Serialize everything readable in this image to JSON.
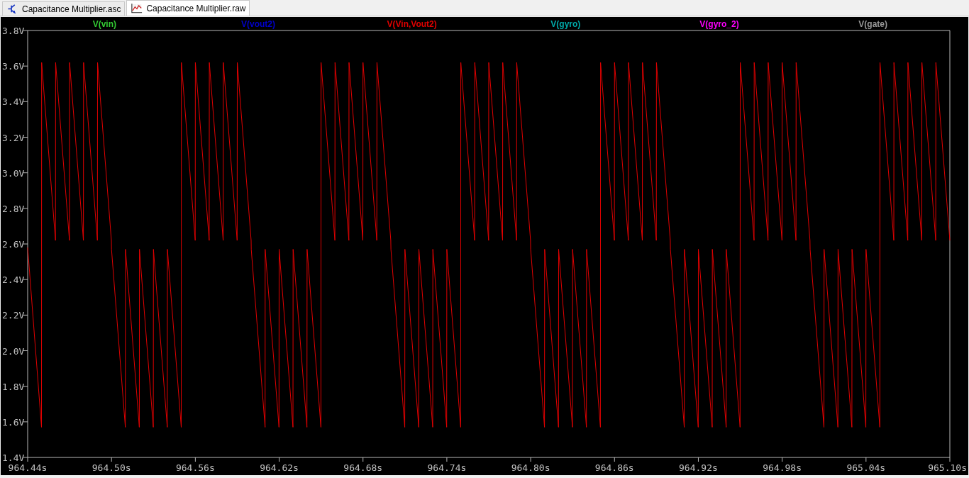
{
  "tabs": [
    {
      "label": "Capacitance Multiplier.asc",
      "kind": "schematic",
      "selected": false
    },
    {
      "label": "Capacitance Multiplier.raw",
      "kind": "waveform",
      "selected": true
    }
  ],
  "plot": {
    "chart_data": {
      "type": "line",
      "xlim": [
        964.44,
        965.1
      ],
      "ylim": [
        1.4,
        3.8
      ],
      "yticks": [
        {
          "value": 1.4,
          "label": "1.4V"
        },
        {
          "value": 1.6,
          "label": "1.6V"
        },
        {
          "value": 1.8,
          "label": "1.8V"
        },
        {
          "value": 2.0,
          "label": "2.0V"
        },
        {
          "value": 2.2,
          "label": "2.2V"
        },
        {
          "value": 2.4,
          "label": "2.4V"
        },
        {
          "value": 2.6,
          "label": "2.6V"
        },
        {
          "value": 2.8,
          "label": "2.8V"
        },
        {
          "value": 3.0,
          "label": "3.0V"
        },
        {
          "value": 3.2,
          "label": "3.2V"
        },
        {
          "value": 3.4,
          "label": "3.4V"
        },
        {
          "value": 3.6,
          "label": "3.6V"
        },
        {
          "value": 3.8,
          "label": "3.8V"
        }
      ],
      "xticks": [
        {
          "value": 964.44,
          "label": "964.44s"
        },
        {
          "value": 964.5,
          "label": "964.50s"
        },
        {
          "value": 964.56,
          "label": "964.56s"
        },
        {
          "value": 964.62,
          "label": "964.62s"
        },
        {
          "value": 964.68,
          "label": "964.68s"
        },
        {
          "value": 964.74,
          "label": "964.74s"
        },
        {
          "value": 964.8,
          "label": "964.80s"
        },
        {
          "value": 964.86,
          "label": "964.86s"
        },
        {
          "value": 964.92,
          "label": "964.92s"
        },
        {
          "value": 964.98,
          "label": "964.98s"
        },
        {
          "value": 965.04,
          "label": "965.04s"
        },
        {
          "value": 965.1,
          "label": "965.10s"
        }
      ],
      "x": [
        964.44,
        964.4499,
        964.45,
        964.4599,
        964.46,
        964.4699,
        964.47,
        964.4799,
        964.48,
        964.4899,
        964.49,
        964.4999,
        964.5,
        964.5099,
        964.51,
        964.5199,
        964.52,
        964.5299,
        964.53,
        964.5399,
        964.54,
        964.5499,
        964.55,
        964.5599,
        964.56,
        964.5699,
        964.57,
        964.5799,
        964.58,
        964.5899,
        964.59,
        964.5999,
        964.6,
        964.6099,
        964.61,
        964.6199,
        964.62,
        964.6299,
        964.63,
        964.6399,
        964.64,
        964.6499,
        964.65,
        964.6599,
        964.66,
        964.6699,
        964.67,
        964.6799,
        964.68,
        964.6899,
        964.69,
        964.6999,
        964.7,
        964.7099,
        964.71,
        964.7199,
        964.72,
        964.7299,
        964.73,
        964.7399,
        964.74,
        964.7499,
        964.75,
        964.7599,
        964.76,
        964.7699,
        964.77,
        964.7799,
        964.78,
        964.7899,
        964.79,
        964.7999,
        964.8,
        964.8099,
        964.81,
        964.8199,
        964.82,
        964.8299,
        964.83,
        964.8399,
        964.84,
        964.8499,
        964.85,
        964.8599,
        964.86,
        964.8699,
        964.87,
        964.8799,
        964.88,
        964.8899,
        964.89,
        964.8999,
        964.9,
        964.9099,
        964.91,
        964.9199,
        964.92,
        964.9299,
        964.93,
        964.9399,
        964.94,
        964.9499,
        964.95,
        964.9599,
        964.96,
        964.9699,
        964.97,
        964.9799,
        964.98,
        964.9899,
        964.99,
        964.9999,
        965.0,
        965.0099,
        965.01,
        965.0199,
        965.02,
        965.0299,
        965.03,
        965.0399,
        965.04,
        965.0499,
        965.05,
        965.0599,
        965.06,
        965.0699,
        965.07,
        965.0799,
        965.08,
        965.0899,
        965.09,
        965.1
      ],
      "series": [
        {
          "name": "V(vin)",
          "color": "#33cc33",
          "values": [
            null,
            null,
            null,
            null,
            null,
            null,
            null,
            null,
            null,
            null,
            null,
            null,
            null,
            null,
            null,
            null,
            null,
            null,
            null,
            null,
            null,
            null,
            null,
            null,
            null,
            null,
            null,
            null,
            null,
            null,
            null,
            null,
            null,
            null,
            null,
            null,
            null,
            null,
            null,
            null,
            null,
            null,
            null,
            null,
            null,
            null,
            null,
            null,
            null,
            null,
            null,
            null,
            null,
            null,
            null,
            null,
            null,
            null,
            null,
            null,
            null,
            null,
            null,
            null,
            null,
            null,
            null,
            null,
            null,
            null,
            null,
            null,
            null,
            null,
            null,
            null,
            null,
            null,
            null,
            null,
            null,
            null,
            null,
            null,
            null,
            null,
            null,
            null,
            null,
            null,
            null,
            null,
            null,
            null,
            null,
            null,
            null,
            null,
            null,
            null,
            null,
            null,
            null,
            null,
            null,
            null,
            null,
            null,
            null,
            null,
            null,
            null,
            null,
            null,
            null,
            null,
            null,
            null,
            null,
            null,
            null,
            null,
            null,
            null,
            null,
            null,
            null,
            null,
            null,
            null,
            null,
            null
          ]
        },
        {
          "name": "V(vout2)",
          "color": "#0000cc",
          "values": [
            null,
            null,
            null,
            null,
            null,
            null,
            null,
            null,
            null,
            null,
            null,
            null,
            null,
            null,
            null,
            null,
            null,
            null,
            null,
            null,
            null,
            null,
            null,
            null,
            null,
            null,
            null,
            null,
            null,
            null,
            null,
            null,
            null,
            null,
            null,
            null,
            null,
            null,
            null,
            null,
            null,
            null,
            null,
            null,
            null,
            null,
            null,
            null,
            null,
            null,
            null,
            null,
            null,
            null,
            null,
            null,
            null,
            null,
            null,
            null,
            null,
            null,
            null,
            null,
            null,
            null,
            null,
            null,
            null,
            null,
            null,
            null,
            null,
            null,
            null,
            null,
            null,
            null,
            null,
            null,
            null,
            null,
            null,
            null,
            null,
            null,
            null,
            null,
            null,
            null,
            null,
            null,
            null,
            null,
            null,
            null,
            null,
            null,
            null,
            null,
            null,
            null,
            null,
            null,
            null,
            null,
            null,
            null,
            null,
            null,
            null,
            null,
            null,
            null,
            null,
            null,
            null,
            null,
            null,
            null,
            null,
            null,
            null,
            null,
            null,
            null,
            null,
            null,
            null,
            null,
            null,
            null
          ]
        },
        {
          "name": "V(Vin,Vout2)",
          "color": "#e00000",
          "values": [
            2.58,
            1.57,
            3.62,
            2.62,
            3.62,
            2.62,
            3.62,
            2.62,
            3.62,
            2.62,
            3.62,
            2.62,
            2.57,
            1.57,
            2.57,
            1.57,
            2.57,
            1.57,
            2.57,
            1.57,
            2.57,
            1.57,
            3.62,
            2.62,
            3.62,
            2.62,
            3.62,
            2.62,
            3.62,
            2.62,
            3.62,
            2.62,
            2.57,
            1.57,
            2.57,
            1.57,
            2.57,
            1.57,
            2.57,
            1.57,
            2.57,
            1.57,
            3.62,
            2.62,
            3.62,
            2.62,
            3.62,
            2.62,
            3.62,
            2.62,
            3.62,
            2.62,
            2.57,
            1.57,
            2.57,
            1.57,
            2.57,
            1.57,
            2.57,
            1.57,
            2.57,
            1.57,
            3.62,
            2.62,
            3.62,
            2.62,
            3.62,
            2.62,
            3.62,
            2.62,
            3.62,
            2.62,
            2.57,
            1.57,
            2.57,
            1.57,
            2.57,
            1.57,
            2.57,
            1.57,
            2.57,
            1.57,
            3.62,
            2.62,
            3.62,
            2.62,
            3.62,
            2.62,
            3.62,
            2.62,
            3.62,
            2.62,
            2.57,
            1.57,
            2.57,
            1.57,
            2.57,
            1.57,
            2.57,
            1.57,
            2.57,
            1.57,
            3.62,
            2.62,
            3.62,
            2.62,
            3.62,
            2.62,
            3.62,
            2.62,
            3.62,
            2.62,
            2.57,
            1.57,
            2.57,
            1.57,
            2.57,
            1.57,
            2.57,
            1.57,
            2.57,
            1.57,
            3.62,
            2.62,
            3.62,
            2.62,
            3.62,
            2.62,
            3.62,
            2.62,
            3.62,
            2.62
          ]
        },
        {
          "name": "V(gyro)",
          "color": "#00aaaa",
          "values": [
            null,
            null,
            null,
            null,
            null,
            null,
            null,
            null,
            null,
            null,
            null,
            null,
            null,
            null,
            null,
            null,
            null,
            null,
            null,
            null,
            null,
            null,
            null,
            null,
            null,
            null,
            null,
            null,
            null,
            null,
            null,
            null,
            null,
            null,
            null,
            null,
            null,
            null,
            null,
            null,
            null,
            null,
            null,
            null,
            null,
            null,
            null,
            null,
            null,
            null,
            null,
            null,
            null,
            null,
            null,
            null,
            null,
            null,
            null,
            null,
            null,
            null,
            null,
            null,
            null,
            null,
            null,
            null,
            null,
            null,
            null,
            null,
            null,
            null,
            null,
            null,
            null,
            null,
            null,
            null,
            null,
            null,
            null,
            null,
            null,
            null,
            null,
            null,
            null,
            null,
            null,
            null,
            null,
            null,
            null,
            null,
            null,
            null,
            null,
            null,
            null,
            null,
            null,
            null,
            null,
            null,
            null,
            null,
            null,
            null,
            null,
            null,
            null,
            null,
            null,
            null,
            null,
            null,
            null,
            null,
            null,
            null,
            null,
            null,
            null,
            null,
            null,
            null,
            null,
            null,
            null,
            null
          ]
        },
        {
          "name": "V(gyro_2)",
          "color": "#ff00ff",
          "values": [
            null,
            null,
            null,
            null,
            null,
            null,
            null,
            null,
            null,
            null,
            null,
            null,
            null,
            null,
            null,
            null,
            null,
            null,
            null,
            null,
            null,
            null,
            null,
            null,
            null,
            null,
            null,
            null,
            null,
            null,
            null,
            null,
            null,
            null,
            null,
            null,
            null,
            null,
            null,
            null,
            null,
            null,
            null,
            null,
            null,
            null,
            null,
            null,
            null,
            null,
            null,
            null,
            null,
            null,
            null,
            null,
            null,
            null,
            null,
            null,
            null,
            null,
            null,
            null,
            null,
            null,
            null,
            null,
            null,
            null,
            null,
            null,
            null,
            null,
            null,
            null,
            null,
            null,
            null,
            null,
            null,
            null,
            null,
            null,
            null,
            null,
            null,
            null,
            null,
            null,
            null,
            null,
            null,
            null,
            null,
            null,
            null,
            null,
            null,
            null,
            null,
            null,
            null,
            null,
            null,
            null,
            null,
            null,
            null,
            null,
            null,
            null,
            null,
            null,
            null,
            null,
            null,
            null,
            null,
            null,
            null,
            null,
            null,
            null,
            null,
            null,
            null,
            null,
            null,
            null,
            null,
            null
          ]
        },
        {
          "name": "V(gate)",
          "color": "#999999",
          "values": [
            null,
            null,
            null,
            null,
            null,
            null,
            null,
            null,
            null,
            null,
            null,
            null,
            null,
            null,
            null,
            null,
            null,
            null,
            null,
            null,
            null,
            null,
            null,
            null,
            null,
            null,
            null,
            null,
            null,
            null,
            null,
            null,
            null,
            null,
            null,
            null,
            null,
            null,
            null,
            null,
            null,
            null,
            null,
            null,
            null,
            null,
            null,
            null,
            null,
            null,
            null,
            null,
            null,
            null,
            null,
            null,
            null,
            null,
            null,
            null,
            null,
            null,
            null,
            null,
            null,
            null,
            null,
            null,
            null,
            null,
            null,
            null,
            null,
            null,
            null,
            null,
            null,
            null,
            null,
            null,
            null,
            null,
            null,
            null,
            null,
            null,
            null,
            null,
            null,
            null,
            null,
            null,
            null,
            null,
            null,
            null,
            null,
            null,
            null,
            null,
            null,
            null,
            null,
            null,
            null,
            null,
            null,
            null,
            null,
            null,
            null,
            null,
            null,
            null,
            null,
            null,
            null,
            null,
            null,
            null,
            null,
            null,
            null,
            null,
            null,
            null,
            null,
            null,
            null,
            null,
            null,
            null
          ]
        }
      ]
    }
  }
}
